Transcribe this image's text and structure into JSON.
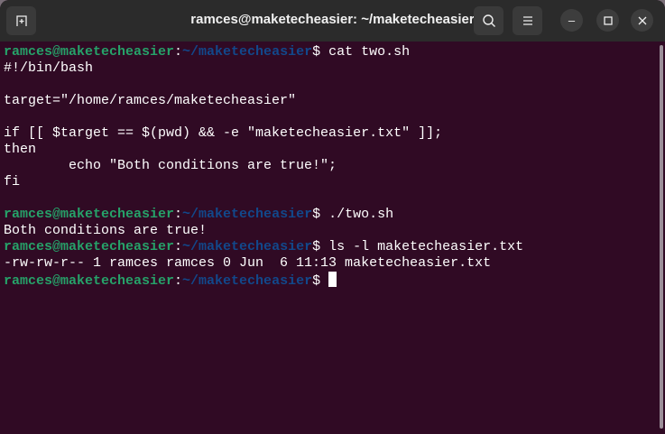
{
  "window": {
    "title": "ramces@maketecheasier: ~/maketecheasier"
  },
  "prompt": {
    "user_host": "ramces@maketecheasier",
    "sep": ":",
    "path": "~/maketecheasier",
    "symbol": "$ "
  },
  "lines": [
    {
      "cmd": "cat two.sh"
    },
    {
      "text": "#!/bin/bash"
    },
    {
      "text": ""
    },
    {
      "text": "target=\"/home/ramces/maketecheasier\""
    },
    {
      "text": ""
    },
    {
      "text": "if [[ $target == $(pwd) && -e \"maketecheasier.txt\" ]];"
    },
    {
      "text": "then"
    },
    {
      "text": "        echo \"Both conditions are true!\";"
    },
    {
      "text": "fi"
    },
    {
      "text": ""
    },
    {
      "cmd": "./two.sh"
    },
    {
      "text": "Both conditions are true!"
    },
    {
      "cmd": "ls -l maketecheasier.txt"
    },
    {
      "text": "-rw-rw-r-- 1 ramces ramces 0 Jun  6 11:13 maketecheasier.txt"
    },
    {
      "cmd": ""
    }
  ]
}
